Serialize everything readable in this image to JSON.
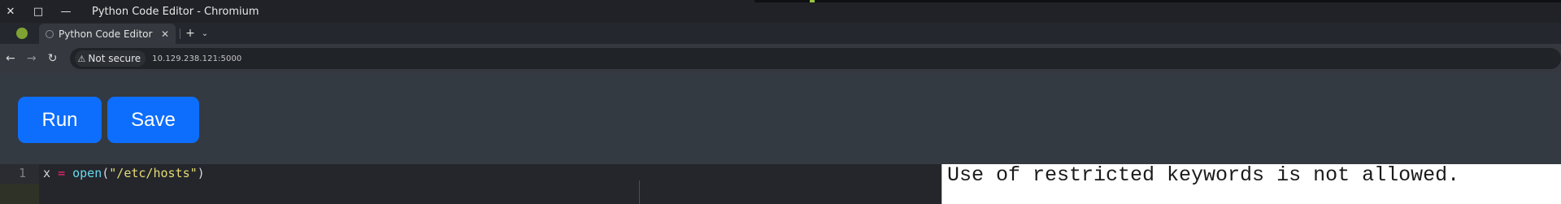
{
  "window": {
    "title": "Python Code Editor - Chromium",
    "controls": {
      "close": "✕",
      "maximize": "□",
      "minimize": "—"
    }
  },
  "tabs": [
    {
      "title": "Python Code Editor",
      "close": "✕",
      "active": true
    }
  ],
  "tabstrip": {
    "new_tab": "+",
    "tab_list": "⌄"
  },
  "toolbar": {
    "back": "←",
    "forward": "→",
    "reload": "↻",
    "security_icon": "⚠",
    "security_text": "Not secure",
    "url": "10.129.238.121:5000"
  },
  "actions": {
    "run_label": "Run",
    "save_label": "Save"
  },
  "editor": {
    "lines": [
      {
        "number": "1",
        "tokens": {
          "var": "x ",
          "op": "=",
          "sp": " ",
          "fn": "open",
          "p1": "(",
          "str": "\"/etc/hosts\"",
          "p2": ")"
        }
      }
    ]
  },
  "output": {
    "text": "Use of restricted keywords is not allowed."
  },
  "colors": {
    "accent": "#0d6efd",
    "page_bg": "#343a41",
    "editor_bg": "#24262c",
    "output_bg": "#ffffff"
  },
  "icons": [
    "warning-icon",
    "back-icon",
    "forward-icon",
    "reload-icon",
    "close-icon",
    "new-tab-icon",
    "chevron-down-icon"
  ]
}
